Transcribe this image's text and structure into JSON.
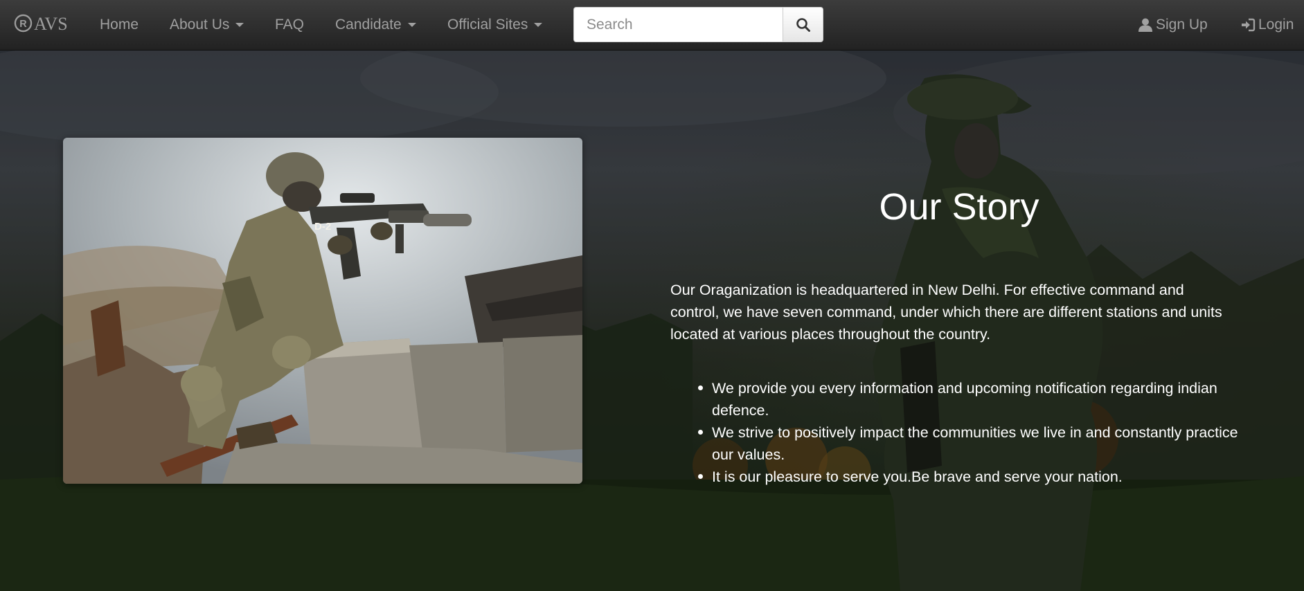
{
  "navbar": {
    "brand": "AVS",
    "items": [
      {
        "label": "Home"
      },
      {
        "label": "About Us"
      },
      {
        "label": "FAQ"
      },
      {
        "label": "Candidate"
      },
      {
        "label": "Official Sites"
      }
    ],
    "search": {
      "placeholder": "Search",
      "value": ""
    },
    "signup_label": "Sign Up",
    "login_label": "Login"
  },
  "story": {
    "title": "Our Story",
    "paragraph": "Our Oraganization is headquartered in New Delhi. For effective command and control, we have seven command, under which there are different stations and units located at various places throughout the country.",
    "points": [
      "We provide you every information and upcoming notification regarding indian defence.",
      "We strive to positively impact the communities we live in and constantly practice our values.",
      "It is our pleasure to serve you.Be brave and serve your nation."
    ]
  },
  "colors": {
    "navbar_bg": "#222222",
    "nav_text": "#a0a0a0",
    "hero_text": "#ffffff"
  }
}
